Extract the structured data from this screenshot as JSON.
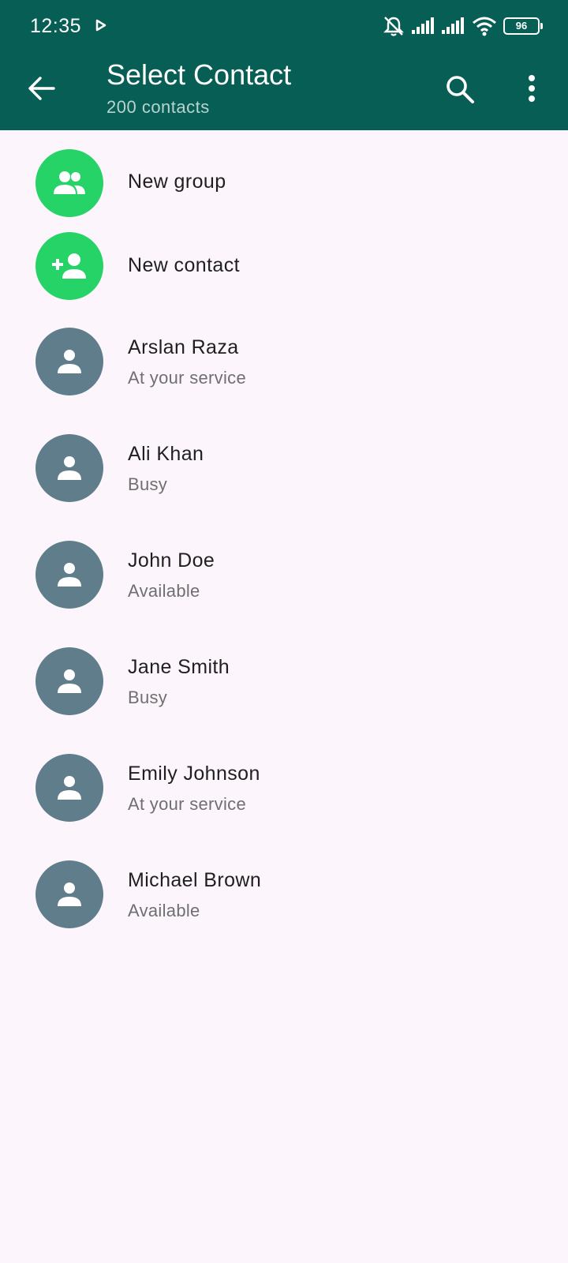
{
  "status_bar": {
    "time": "12:35",
    "battery": "96",
    "icons": [
      "play-icon",
      "mute-icon",
      "signal-icon",
      "signal-icon",
      "wifi-icon",
      "battery-icon"
    ]
  },
  "header": {
    "title": "Select Contact",
    "subtitle": "200 contacts",
    "icons": [
      "back-arrow-icon",
      "search-icon",
      "more-vert-icon"
    ]
  },
  "actions": [
    {
      "label": "New group",
      "icon": "group-icon"
    },
    {
      "label": "New contact",
      "icon": "add-person-icon"
    }
  ],
  "contacts": [
    {
      "name": "Arslan Raza",
      "status": "At your service"
    },
    {
      "name": "Ali Khan",
      "status": "Busy"
    },
    {
      "name": "John Doe",
      "status": "Available"
    },
    {
      "name": "Jane Smith",
      "status": "Busy"
    },
    {
      "name": "Emily Johnson",
      "status": "At your service"
    },
    {
      "name": "Michael Brown",
      "status": "Available"
    }
  ],
  "colors": {
    "header": "#075e55",
    "accent_green": "#25d366",
    "avatar_grey": "#607d8b",
    "background": "#fcf6fc"
  }
}
